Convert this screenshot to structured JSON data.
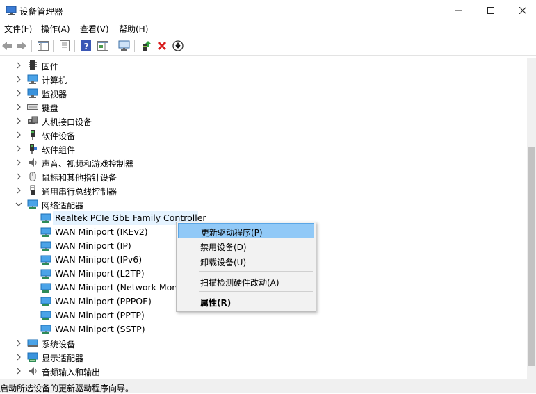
{
  "window": {
    "title": "设备管理器",
    "minimize": "—",
    "maximize": "☐",
    "close": "✕"
  },
  "menubar": {
    "items": [
      "文件(F)",
      "操作(A)",
      "查看(V)",
      "帮助(H)"
    ]
  },
  "tree": {
    "categories_top": [
      {
        "label": "固件",
        "icon": "firmware-icon"
      },
      {
        "label": "计算机",
        "icon": "computer-icon"
      },
      {
        "label": "监视器",
        "icon": "monitor-icon"
      },
      {
        "label": "键盘",
        "icon": "keyboard-icon"
      },
      {
        "label": "人机接口设备",
        "icon": "hid-icon"
      },
      {
        "label": "软件设备",
        "icon": "software-device-icon"
      },
      {
        "label": "软件组件",
        "icon": "software-component-icon"
      },
      {
        "label": "声音、视频和游戏控制器",
        "icon": "speaker-icon"
      },
      {
        "label": "鼠标和其他指针设备",
        "icon": "mouse-icon"
      },
      {
        "label": "通用串行总线控制器",
        "icon": "usb-icon"
      }
    ],
    "expanded": {
      "label": "网络适配器",
      "icon": "network-adapter-icon"
    },
    "adapters": [
      "Realtek PCIe GbE Family Controller",
      "WAN Miniport (IKEv2)",
      "WAN Miniport (IP)",
      "WAN Miniport (IPv6)",
      "WAN Miniport (L2TP)",
      "WAN Miniport (Network Monitor)",
      "WAN Miniport (PPPOE)",
      "WAN Miniport (PPTP)",
      "WAN Miniport (SSTP)"
    ],
    "categories_bottom": [
      {
        "label": "系统设备",
        "icon": "system-device-icon"
      },
      {
        "label": "显示适配器",
        "icon": "display-adapter-icon"
      },
      {
        "label": "音频输入和输出",
        "icon": "audio-io-icon"
      }
    ]
  },
  "context_menu": {
    "update_driver": "更新驱动程序(P)",
    "disable_device": "禁用设备(D)",
    "uninstall_device": "卸载设备(U)",
    "scan_hardware": "扫描检测硬件改动(A)",
    "properties": "属性(R)"
  },
  "status": {
    "text": "启动所选设备的更新驱动程序向导。"
  },
  "colors": {
    "selection": "#e5f3ff",
    "menu_highlight": "#91c9f7",
    "accent": "#0078d7"
  }
}
